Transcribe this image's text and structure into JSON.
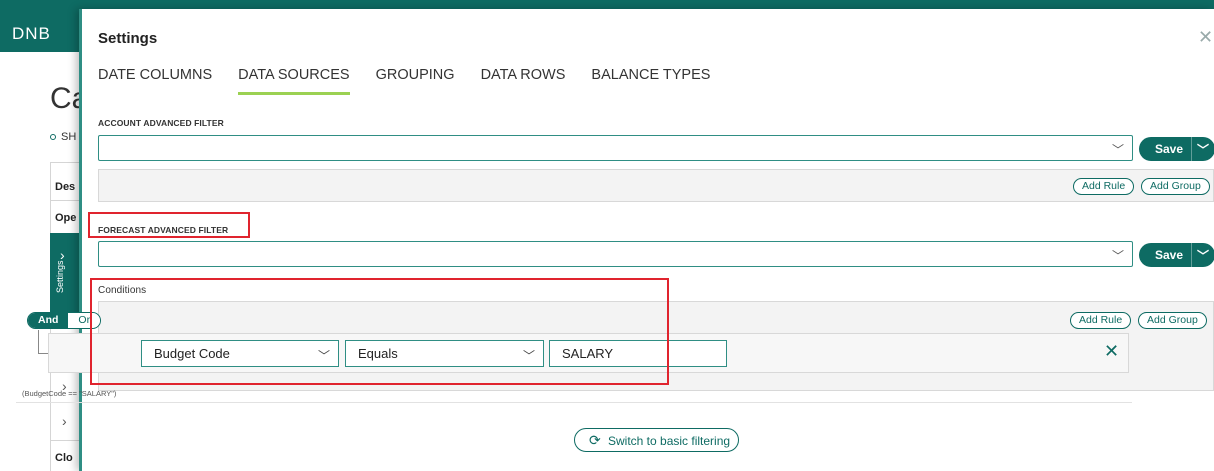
{
  "app": {
    "logo": "DNB",
    "title_partial": "Ca",
    "subtitle_partial": "SH",
    "sidebar_labels": [
      "Des",
      "Ope",
      "Clo"
    ],
    "settings_tab": "Settings"
  },
  "dialog": {
    "title": "Settings",
    "tabs": [
      {
        "label": "DATE COLUMNS",
        "active": false
      },
      {
        "label": "DATA SOURCES",
        "active": true
      },
      {
        "label": "GROUPING",
        "active": false
      },
      {
        "label": "DATA ROWS",
        "active": false
      },
      {
        "label": "BALANCE TYPES",
        "active": false
      }
    ],
    "account_filter": {
      "label": "ACCOUNT ADVANCED FILTER",
      "value": "",
      "save_label": "Save",
      "add_rule": "Add Rule",
      "add_group": "Add Group"
    },
    "forecast_filter": {
      "label": "FORECAST ADVANCED FILTER",
      "value": "",
      "save_label": "Save",
      "conditions_label": "Conditions",
      "and_label": "And",
      "or_label": "Or",
      "add_rule": "Add Rule",
      "add_group": "Add Group",
      "condition": {
        "field": "Budget Code",
        "operator": "Equals",
        "value": "SALARY"
      },
      "expression": "(BudgetCode == \"SALARY\")"
    },
    "switch_label": "Switch to basic filtering"
  },
  "colors": {
    "brand": "#0e6b63",
    "tab_underline": "#9bd152",
    "highlight": "#e0242e"
  }
}
